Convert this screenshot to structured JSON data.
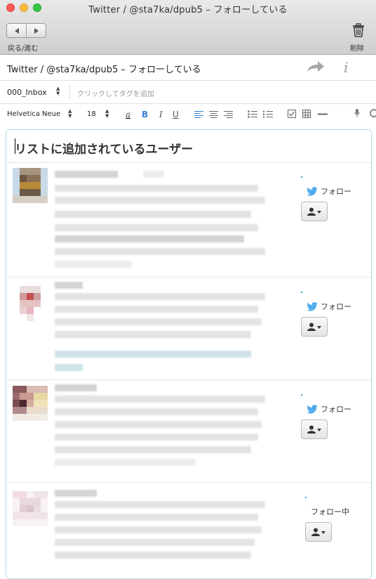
{
  "window": {
    "title": "Twitter / @sta7ka/dpub5 – フォローしている",
    "nav_label": "戻る/進む",
    "delete_label": "削除"
  },
  "note": {
    "title": "Twitter / @sta7ka/dpub5 – フォローしている",
    "notebook": "000_Inbox",
    "tag_placeholder": "クリックしてタグを追加"
  },
  "format_toolbar": {
    "font": "Helvetica Neue",
    "size": "18",
    "color_btn": "a",
    "bold": "B",
    "italic": "I",
    "underline": "U"
  },
  "content": {
    "heading": "リストに追加されているユーザー",
    "users": [
      {
        "follow_label": "フォロー",
        "following": false
      },
      {
        "follow_label": "フォロー",
        "following": false
      },
      {
        "follow_label": "フォロー",
        "following": false
      },
      {
        "follow_label": "フォロー中",
        "following": true
      }
    ]
  },
  "colors": {
    "accent": "#3a7fd0",
    "twitter_blue": "#55acee",
    "card_border": "#b7d9e8"
  },
  "icons": [
    "back-icon",
    "forward-icon",
    "trash-icon",
    "share-icon",
    "info-icon",
    "twitter-bird-icon",
    "user-icon",
    "microphone-icon"
  ]
}
